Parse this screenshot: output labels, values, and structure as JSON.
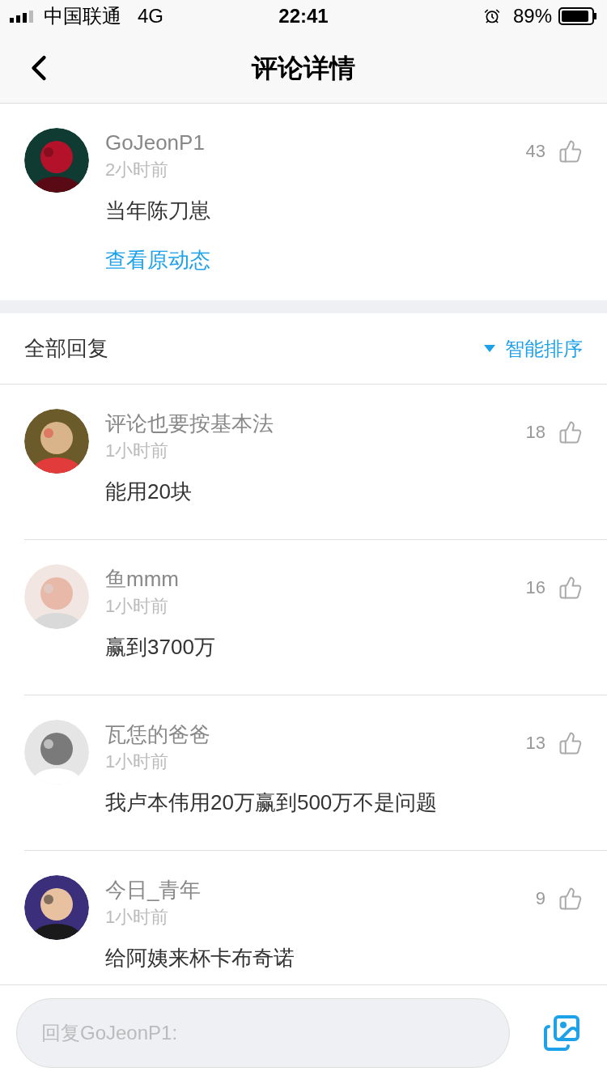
{
  "status_bar": {
    "carrier": "中国联通",
    "network": "4G",
    "time": "22:41",
    "battery": "89%"
  },
  "nav": {
    "title": "评论详情"
  },
  "comment": {
    "user": "GoJeonP1",
    "time": "2小时前",
    "text": "当年陈刀崽",
    "likes": "43",
    "link": "查看原动态"
  },
  "replies_header": {
    "title": "全部回复",
    "sort": "智能排序"
  },
  "replies": [
    {
      "user": "评论也要按基本法",
      "time": "1小时前",
      "text": "能用20块",
      "likes": "18"
    },
    {
      "user": "鱼mmm",
      "time": "1小时前",
      "text": "赢到3700万",
      "likes": "16"
    },
    {
      "user": "瓦恁的爸爸",
      "time": "1小时前",
      "text": "我卢本伟用20万赢到500万不是问题",
      "likes": "13"
    },
    {
      "user": "今日_青年",
      "time": "1小时前",
      "text": "给阿姨来杯卡布奇诺",
      "likes": "9"
    }
  ],
  "reply_bar": {
    "placeholder": "回复GoJeonP1:"
  }
}
